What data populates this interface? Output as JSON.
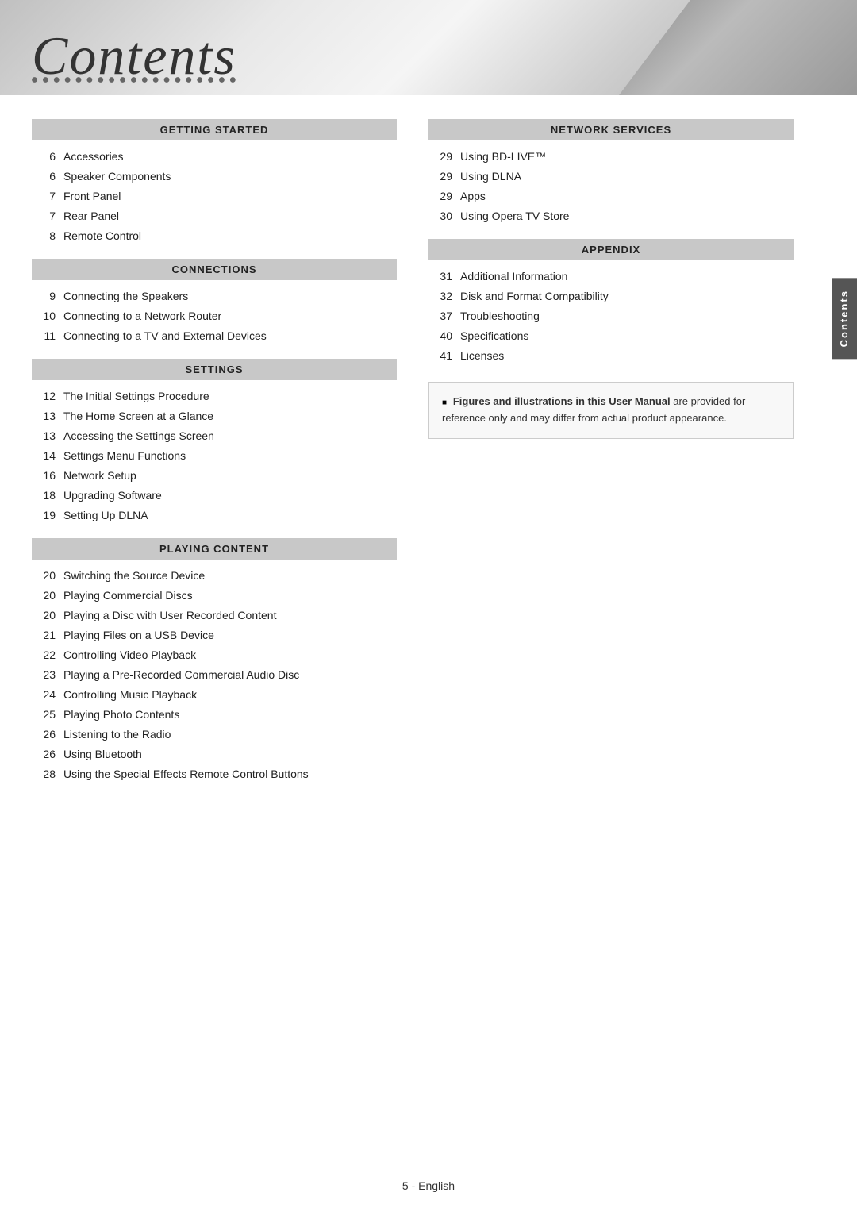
{
  "header": {
    "title": "Contents"
  },
  "side_tab": {
    "label": "Contents"
  },
  "left_column": {
    "sections": [
      {
        "id": "getting-started",
        "header": "GETTING STARTED",
        "entries": [
          {
            "number": "6",
            "text": "Accessories"
          },
          {
            "number": "6",
            "text": "Speaker Components"
          },
          {
            "number": "7",
            "text": "Front Panel"
          },
          {
            "number": "7",
            "text": "Rear Panel"
          },
          {
            "number": "8",
            "text": "Remote Control"
          }
        ]
      },
      {
        "id": "connections",
        "header": "CONNECTIONS",
        "entries": [
          {
            "number": "9",
            "text": "Connecting the Speakers"
          },
          {
            "number": "10",
            "text": "Connecting to a Network Router"
          },
          {
            "number": "11",
            "text": "Connecting to a TV and External Devices"
          }
        ]
      },
      {
        "id": "settings",
        "header": "SETTINGS",
        "entries": [
          {
            "number": "12",
            "text": "The Initial Settings Procedure"
          },
          {
            "number": "13",
            "text": "The Home Screen at a Glance"
          },
          {
            "number": "13",
            "text": "Accessing the Settings Screen"
          },
          {
            "number": "14",
            "text": "Settings Menu Functions"
          },
          {
            "number": "16",
            "text": "Network Setup"
          },
          {
            "number": "18",
            "text": "Upgrading Software"
          },
          {
            "number": "19",
            "text": "Setting Up DLNA"
          }
        ]
      },
      {
        "id": "playing-content",
        "header": "PLAYING CONTENT",
        "entries": [
          {
            "number": "20",
            "text": "Switching the Source Device"
          },
          {
            "number": "20",
            "text": "Playing Commercial Discs"
          },
          {
            "number": "20",
            "text": "Playing a Disc with User Recorded Content"
          },
          {
            "number": "21",
            "text": "Playing Files on a USB Device"
          },
          {
            "number": "22",
            "text": "Controlling Video Playback"
          },
          {
            "number": "23",
            "text": "Playing a Pre-Recorded Commercial Audio Disc"
          },
          {
            "number": "24",
            "text": "Controlling Music Playback"
          },
          {
            "number": "25",
            "text": "Playing Photo Contents"
          },
          {
            "number": "26",
            "text": "Listening to the Radio"
          },
          {
            "number": "26",
            "text": "Using Bluetooth"
          },
          {
            "number": "28",
            "text": "Using the Special Effects Remote Control Buttons"
          }
        ]
      }
    ]
  },
  "right_column": {
    "sections": [
      {
        "id": "network-services",
        "header": "NETWORK SERVICES",
        "entries": [
          {
            "number": "29",
            "text": "Using BD-LIVE™"
          },
          {
            "number": "29",
            "text": "Using DLNA"
          },
          {
            "number": "29",
            "text": "Apps"
          },
          {
            "number": "30",
            "text": "Using Opera TV Store"
          }
        ]
      },
      {
        "id": "appendix",
        "header": "APPENDIX",
        "entries": [
          {
            "number": "31",
            "text": "Additional Information"
          },
          {
            "number": "32",
            "text": "Disk and Format Compatibility"
          },
          {
            "number": "37",
            "text": "Troubleshooting"
          },
          {
            "number": "40",
            "text": "Specifications"
          },
          {
            "number": "41",
            "text": "Licenses"
          }
        ]
      }
    ],
    "note": {
      "bullet": "■",
      "text_bold": "Figures and illustrations in this User Manual",
      "text_normal": "are provided for reference only and may differ from actual product appearance."
    }
  },
  "footer": {
    "text": "5 - English"
  }
}
